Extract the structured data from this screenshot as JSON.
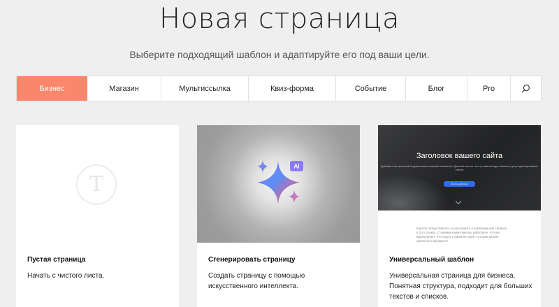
{
  "page": {
    "title": "Новая страница",
    "subtitle": "Выберите подходящий шаблон и адаптируйте его под ваши цели."
  },
  "tabs": [
    {
      "label": "Бизнес",
      "active": true
    },
    {
      "label": "Магазин",
      "active": false
    },
    {
      "label": "Мультиссылка",
      "active": false
    },
    {
      "label": "Квиз-форма",
      "active": false
    },
    {
      "label": "Событие",
      "active": false
    },
    {
      "label": "Блог",
      "active": false
    },
    {
      "label": "Pro",
      "active": false
    }
  ],
  "search_icon": "search-icon",
  "colors": {
    "accent": "#fa876b",
    "background": "#efefef",
    "card": "#ffffff",
    "ai_badge": "#8b7cf6",
    "site_button": "#2f6cf6"
  },
  "cards": [
    {
      "title": "Пустая страница",
      "description": "Начать с чистого листа.",
      "thumb": {
        "logo_glyph": "Т"
      }
    },
    {
      "title": "Сгенерировать страницу",
      "description": "Создать страницу с помощью искусственного интеллекта.",
      "thumb": {
        "badge": "AI"
      }
    },
    {
      "title": "Универсальный шаблон",
      "description": "Универсальная страница для бизнеса. Понятная структура, подходит для больших текстов и списков.",
      "thumb": {
        "hero_title": "Заголовок вашего сайта",
        "hero_text": "Добавьте интересный подзаголовок к вашей компании. Донный сам по тексту вам выгодно вписать для редактирования текста",
        "hero_button": "Кнопка действия",
        "body_text": "Коротко представьтесь и расскажите о компании или сервисе в 3-4 строках. С какими клиентами вы работаете, что вас вдохновляет. Что подгото ваша история, которая делает ценность в аргументе."
      }
    }
  ]
}
